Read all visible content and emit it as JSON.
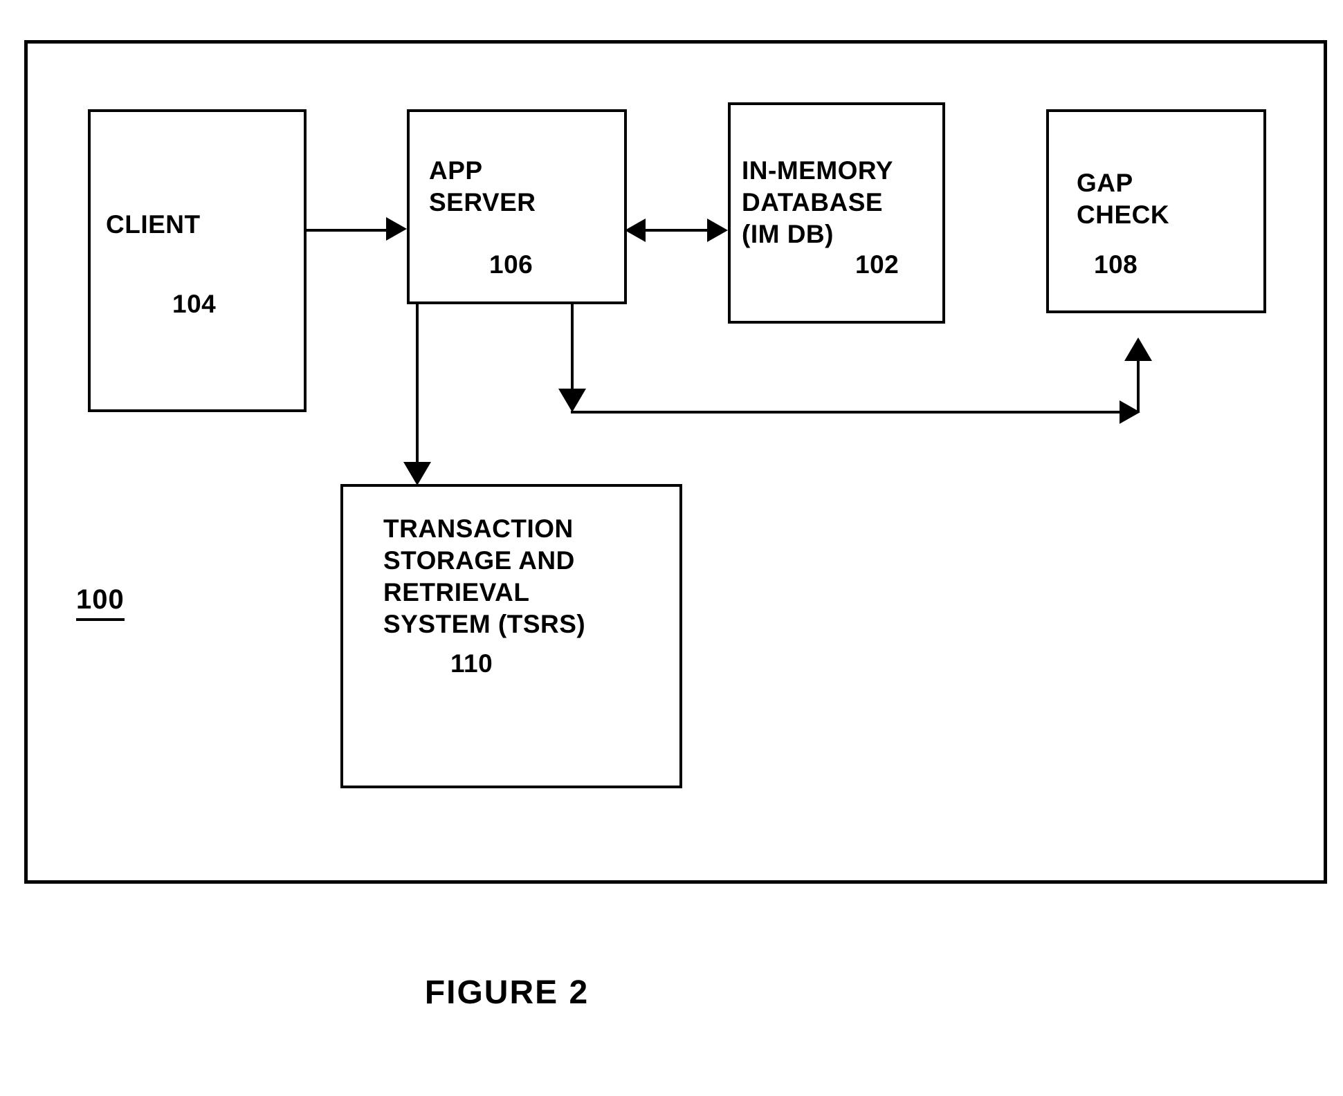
{
  "figure": {
    "caption": "FIGURE 2",
    "system_ref": "100"
  },
  "nodes": [
    {
      "id": "client",
      "label": "CLIENT",
      "ref": "104"
    },
    {
      "id": "app_server",
      "label": "APP\nSERVER",
      "ref": "106"
    },
    {
      "id": "imdb",
      "label": "IN-MEMORY\nDATABASE\n(IM DB)",
      "ref": "102"
    },
    {
      "id": "gap_check",
      "label": "GAP\nCHECK",
      "ref": "108"
    },
    {
      "id": "tsrs",
      "label": "TRANSACTION\nSTORAGE AND\nRETRIEVAL\nSYSTEM (TSRS)",
      "ref": "110"
    }
  ],
  "connections": [
    {
      "id": "client-to-app-server",
      "from": "client",
      "to": "app_server",
      "direction": "one-way"
    },
    {
      "id": "app-server-to-imdb",
      "from": "app_server",
      "to": "imdb",
      "direction": "bidirectional"
    },
    {
      "id": "app-server-to-tsrs",
      "from": "app_server",
      "to": "tsrs",
      "direction": "one-way"
    },
    {
      "id": "app-server-to-gap-check",
      "from": "app_server",
      "to": "gap_check",
      "direction": "one-way"
    }
  ],
  "colors": {
    "ink": "#000000",
    "paper": "#ffffff"
  }
}
